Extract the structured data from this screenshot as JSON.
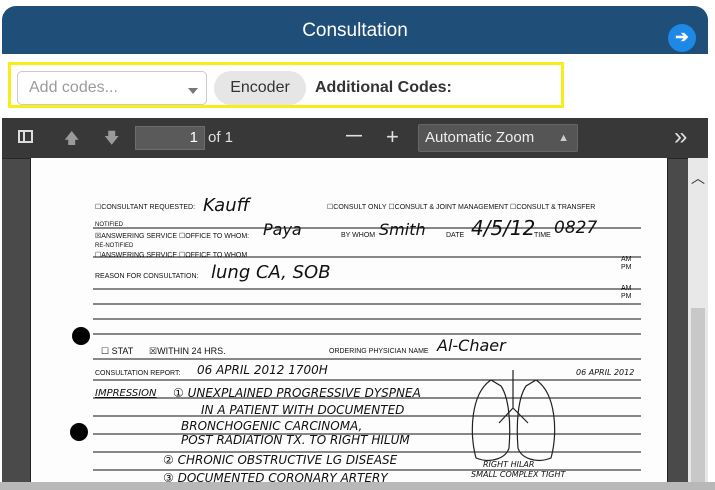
{
  "header": {
    "title": "Consultation",
    "nav_icon": "arrow-right-circle-icon"
  },
  "codes": {
    "placeholder": "Add codes...",
    "encoder_label": "Encoder",
    "additional_label": "Additional Codes:"
  },
  "toolbar": {
    "page_number": "1",
    "page_count": "of 1",
    "zoom_out": "—",
    "zoom_in": "+",
    "zoom": "Automatic Zoom",
    "more": "»"
  },
  "document": {
    "row1_consultant": "☐CONSULTANT REQUESTED:",
    "row1_consultant_value": "Kauff",
    "row1_options": "☐CONSULT ONLY ☐CONSULT & JOINT MANAGEMENT ☐CONSULT & TRANSFER",
    "notified_label": "NOTIFIED",
    "answering_1": "☒ANSWERING SERVICE  ☐OFFICE TO WHOM:",
    "answering_1_value": "Paya",
    "by_whom": "BY WHOM",
    "by_whom_value": "Smith",
    "date_label": "DATE",
    "date_value": "4/5/12",
    "time_label": "TIME",
    "time_value": "0827",
    "re_notified": "RE-NOTIFIED",
    "answering_2": "☐ANSWERING SERVICE  ☐OFFICE TO WHOM",
    "reason_label": "REASON FOR CONSULTATION:",
    "reason_value": "lung CA, SOB",
    "stat": "☐ STAT",
    "within": "☒WITHIN 24 HRS.",
    "ordering": "ORDERING PHYSICIAN NAME",
    "ordering_value": "Al-Chaer",
    "report_label": "CONSULTATION REPORT:",
    "report_value": "06 APRIL 2012  1700H",
    "report_date_right": "06 APRIL 2012",
    "impression": "IMPRESSION",
    "line1": "① UNEXPLAINED PROGRESSIVE DYSPNEA",
    "line2": "IN A PATIENT WITH DOCUMENTED",
    "line3": "BRONCHOGENIC CARCINOMA,",
    "line4": "POST RADIATION TX. TO RIGHT HILUM",
    "line5": "② CHRONIC OBSTRUCTIVE LG DISEASE",
    "line6": "③ DOCUMENTED CORONARY ARTERY",
    "diagram_label1": "RIGHT HILAR",
    "diagram_label2": "SMALL COMPLEX TIGHT"
  },
  "colors": {
    "header": "#1f4e79",
    "highlight": "#f5ee1a",
    "nav": "#1e88e5"
  }
}
